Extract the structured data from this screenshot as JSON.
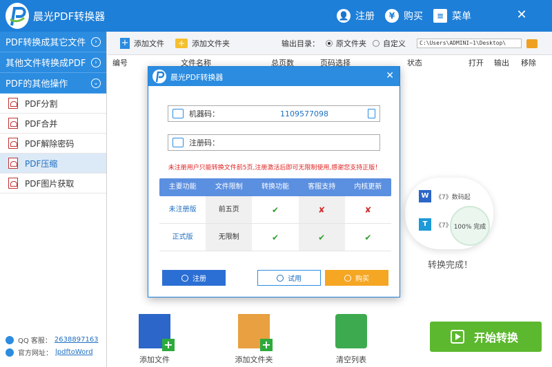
{
  "app": {
    "title": "晨光PDF转换器"
  },
  "titlebar": {
    "register_label": "注册",
    "register_icon": "user-icon",
    "buy_label": "购买",
    "buy_icon": "yen-icon",
    "menu_label": "菜单",
    "menu_icon": "menu-icon",
    "close_icon": "close-icon"
  },
  "sidebar": {
    "groups": [
      {
        "label": "PDF转换成其它文件",
        "icon": "chevron-right-icon"
      },
      {
        "label": "其他文件转换成PDF",
        "icon": "chevron-right-icon"
      },
      {
        "label": "PDF的其他操作",
        "icon": "chevron-down-icon"
      }
    ],
    "items": [
      {
        "label": "PDF分割",
        "icon": "pdf-icon",
        "active": false
      },
      {
        "label": "PDF合并",
        "icon": "pdf-icon",
        "active": false
      },
      {
        "label": "PDF解除密码",
        "icon": "pdf-icon",
        "active": false
      },
      {
        "label": "PDF压缩",
        "icon": "pdf-icon",
        "active": true
      },
      {
        "label": "PDF图片获取",
        "icon": "pdf-icon",
        "active": false
      }
    ],
    "qq_label": "QQ 客服：",
    "qq_value": "2638897163",
    "site_label": "官方网址：",
    "site_value": "lpdftoWord"
  },
  "toolbar": {
    "add_file": "添加文件",
    "add_folder": "添加文件夹",
    "output_label": "输出目录：",
    "opt_original": "原文件夹",
    "opt_custom": "自定义",
    "selected_option": "原文件夹",
    "path": "C:\\Users\\ADMINI~1\\Desktop\\"
  },
  "columns": [
    "编号",
    "文件名称",
    "总页数",
    "页码选择",
    "状态",
    "打开",
    "输出",
    "移除"
  ],
  "background": {
    "row1_text": "《7》数码起",
    "row2_text": "《7》",
    "progress_text": "100%  完成",
    "done_text": "转换完成！"
  },
  "bottom": {
    "add_file": "添加文件",
    "add_folder": "添加文件夹",
    "clear_list": "清空列表",
    "start": "开始转换"
  },
  "modal": {
    "title": "晨光PDF转换器",
    "machine_label": "机器码：",
    "machine_code": "1109577098",
    "regcode_label": "注册码：",
    "regcode_value": "",
    "notice": "未注册用户只能转换文件前5页,注册激活后即可无限制使用,感谢您支持正版！",
    "table": {
      "headers": [
        "主要功能",
        "文件限制",
        "转换功能",
        "客服支持",
        "内核更新"
      ],
      "rows": [
        {
          "label": "未注册版",
          "limit": "前五页",
          "convert": "✔",
          "support": "✘",
          "update": "✘"
        },
        {
          "label": "正式版",
          "limit": "无限制",
          "convert": "✔",
          "support": "✔",
          "update": "✔"
        }
      ]
    },
    "btn_register": "注册",
    "btn_trial": "试用",
    "btn_buy": "购买"
  },
  "colors": {
    "titlebar": "#1e7fd8",
    "sidebar_head": "#2b8ce0",
    "start_button": "#5cb82e",
    "buy_button": "#f5a623",
    "notice_red": "#e02020"
  }
}
